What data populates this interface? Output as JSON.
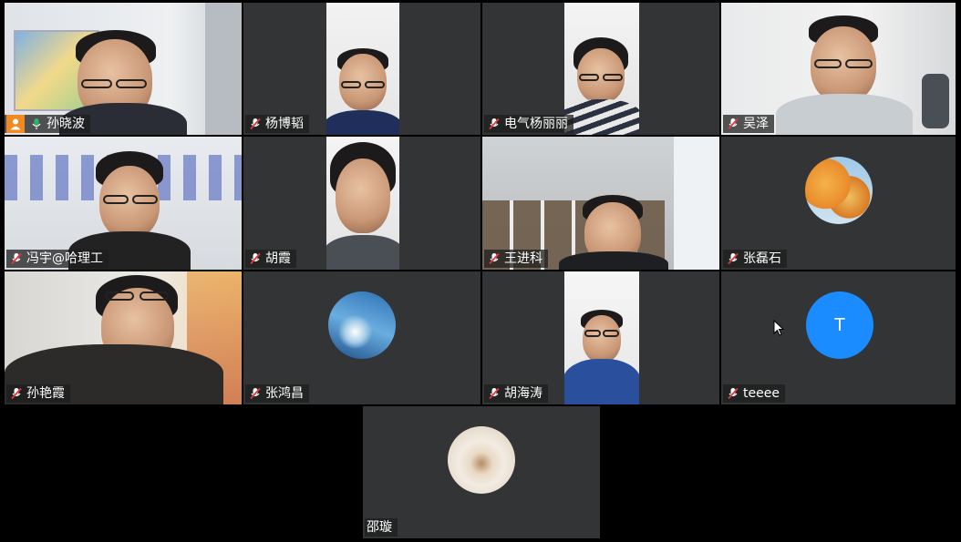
{
  "participants": [
    {
      "name": "孙晓波",
      "mic": "on",
      "host": true
    },
    {
      "name": "杨博韬",
      "mic": "muted"
    },
    {
      "name": "电气杨丽丽",
      "mic": "muted"
    },
    {
      "name": "吴泽",
      "mic": "muted"
    },
    {
      "name": "冯宇@哈理工",
      "mic": "muted"
    },
    {
      "name": "胡霞",
      "mic": "muted"
    },
    {
      "name": "王进科",
      "mic": "muted"
    },
    {
      "name": "张磊石",
      "mic": "muted"
    },
    {
      "name": "孙艳霞",
      "mic": "muted"
    },
    {
      "name": "张鸿昌",
      "mic": "muted"
    },
    {
      "name": "胡海涛",
      "mic": "muted"
    },
    {
      "name": "teeee",
      "mic": "muted",
      "avatar_letter": "T"
    },
    {
      "name": "邵璇"
    }
  ],
  "colors": {
    "tile_bg": "#333436",
    "active_border": "#2fb36b",
    "muted_mic": "#e0383e",
    "host_badge": "#f18b21",
    "letter_avatar": "#1a8cff"
  },
  "icons": {
    "muted": "mic-muted-icon",
    "unmuted": "mic-on-icon",
    "host": "host-person-icon",
    "cursor": "mouse-pointer-icon"
  }
}
